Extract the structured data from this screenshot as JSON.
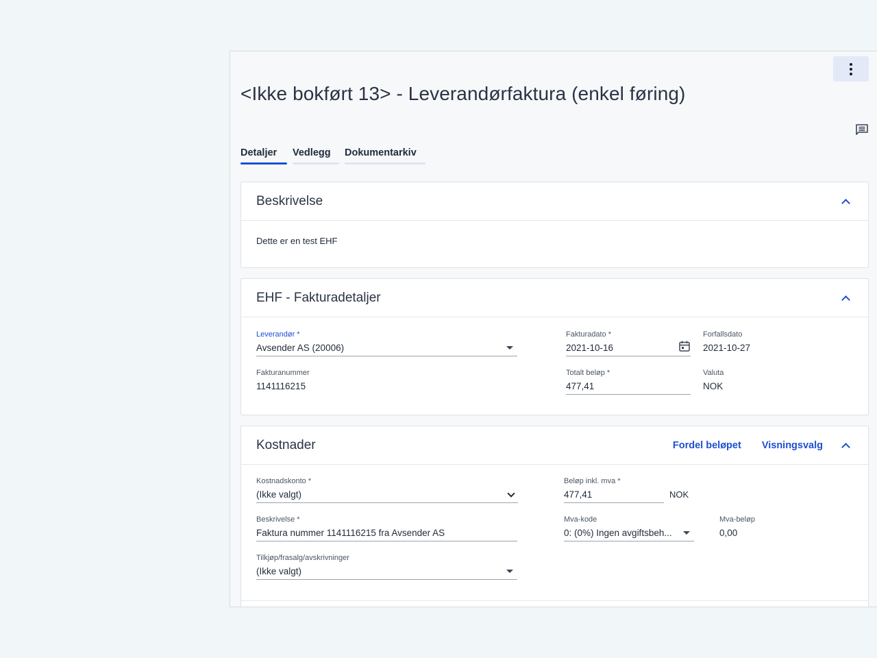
{
  "page": {
    "title": "<Ikke bokført 13> - Leverandørfaktura (enkel føring)"
  },
  "toolbar": {
    "more_icon": "more-vertical-icon",
    "comment_icon": "comment-icon"
  },
  "tabs": [
    {
      "label": "Detaljer",
      "active": true
    },
    {
      "label": "Vedlegg",
      "active": false
    },
    {
      "label": "Dokumentarkiv",
      "active": false
    }
  ],
  "beskrivelse": {
    "title": "Beskrivelse",
    "text": "Dette er en test EHF"
  },
  "ehf": {
    "title": "EHF - Fakturadetaljer",
    "leverandor": {
      "label": "Leverandør *",
      "value": "Avsender AS (20006)"
    },
    "fakturadato": {
      "label": "Fakturadato *",
      "value": "2021-10-16"
    },
    "forfallsdato": {
      "label": "Forfallsdato",
      "value": "2021-10-27"
    },
    "fakturanummer": {
      "label": "Fakturanummer",
      "value": "1141116215"
    },
    "totalt_belop": {
      "label": "Totalt beløp *",
      "value": "477,41"
    },
    "valuta": {
      "label": "Valuta",
      "value": "NOK"
    }
  },
  "kostnader": {
    "title": "Kostnader",
    "fordel_label": "Fordel beløpet",
    "visningsvalg_label": "Visningsvalg",
    "kostnadskonto": {
      "label": "Kostnadskonto *",
      "value": "(Ikke valgt)"
    },
    "belop_inkl_mva": {
      "label": "Beløp inkl. mva *",
      "value": "477,41",
      "suffix": "NOK"
    },
    "beskrivelse": {
      "label": "Beskrivelse *",
      "value": "Faktura nummer 1141116215 fra Avsender AS"
    },
    "mva_kode": {
      "label": "Mva-kode",
      "value": "0: (0%) Ingen avgiftsbeh..."
    },
    "mva_belop": {
      "label": "Mva-beløp",
      "value": "0,00"
    },
    "tilkjop": {
      "label": "Tilkjøp/frasalg/avskrivninger",
      "value": "(Ikke valgt)"
    }
  }
}
